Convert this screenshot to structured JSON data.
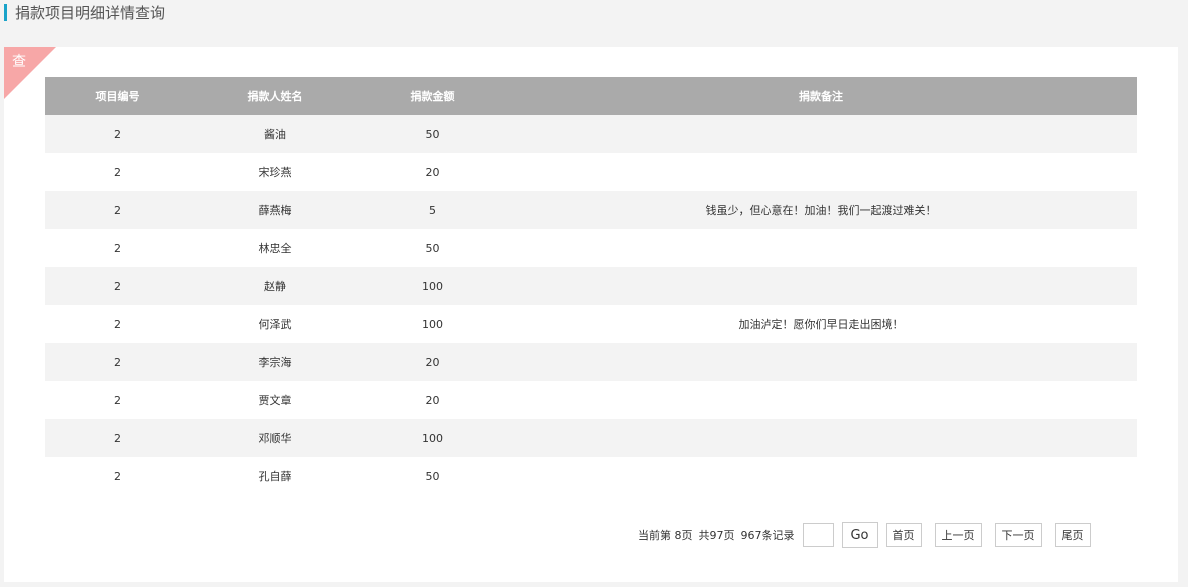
{
  "page": {
    "title": "捐款项目明细详情查询"
  },
  "panel": {
    "corner_label": "查"
  },
  "table": {
    "headers": [
      "项目编号",
      "捐款人姓名",
      "捐款金额",
      "捐款备注"
    ],
    "rows": [
      [
        "2",
        "酱油",
        "50",
        ""
      ],
      [
        "2",
        "宋珍燕",
        "20",
        ""
      ],
      [
        "2",
        "薛燕梅",
        "5",
        "钱虽少，但心意在！加油！我们一起渡过难关！"
      ],
      [
        "2",
        "林忠全",
        "50",
        ""
      ],
      [
        "2",
        "赵静",
        "100",
        ""
      ],
      [
        "2",
        "何泽武",
        "100",
        "加油泸定！愿你们早日走出困境！"
      ],
      [
        "2",
        "李宗海",
        "20",
        ""
      ],
      [
        "2",
        "贾文章",
        "20",
        ""
      ],
      [
        "2",
        "邓顺华",
        "100",
        ""
      ],
      [
        "2",
        "孔自薛",
        "50",
        ""
      ]
    ]
  },
  "pager": {
    "current_page_text": "当前第  8页",
    "total_pages_text": "共97页",
    "total_records_text": "967条记录",
    "page_input_value": "",
    "go_label": "Go",
    "first_label": "首页",
    "prev_label": "上一页",
    "next_label": "下一页",
    "last_label": "尾页"
  },
  "colors": {
    "accent": "#1aa3c9",
    "corner": "#f7a7a7",
    "header_bg": "#aaaaaa",
    "stripe": "#f3f3f3"
  }
}
